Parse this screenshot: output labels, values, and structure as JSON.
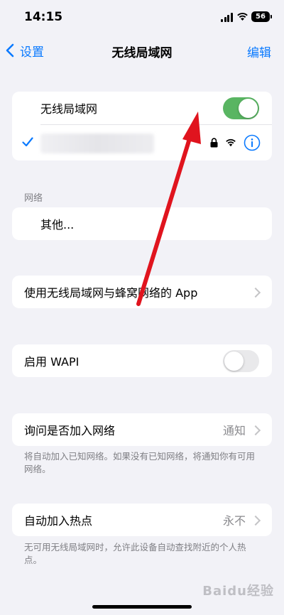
{
  "status_bar": {
    "time": "14:15",
    "battery": "56"
  },
  "nav": {
    "back_label": "设置",
    "title": "无线局域网",
    "edit_label": "编辑"
  },
  "wifi_card": {
    "toggle_label": "无线局域网",
    "toggle_on": true
  },
  "networks_section": {
    "header": "网络",
    "other_label": "其他..."
  },
  "apps_row": {
    "label": "使用无线局域网与蜂窝网络的 App"
  },
  "wapi_row": {
    "label": "启用 WAPI",
    "toggle_on": false
  },
  "ask_join": {
    "label": "询问是否加入网络",
    "value": "通知",
    "footnote": "将自动加入已知网络。如果没有已知网络，将通知你有可用网络。"
  },
  "auto_hotspot": {
    "label": "自动加入热点",
    "value": "永不",
    "footnote": "无可用无线局域网时，允许此设备自动查找附近的个人热点。"
  },
  "watermark": "Baidu经验",
  "colors": {
    "accent": "#0a7aff",
    "toggle_on": "#59b562",
    "annotation_arrow": "#e0141e"
  },
  "icons": [
    "chevron-left-icon",
    "checkmark-icon",
    "lock-icon",
    "wifi-icon",
    "info-icon",
    "chevron-right-icon",
    "annotation-arrow"
  ]
}
